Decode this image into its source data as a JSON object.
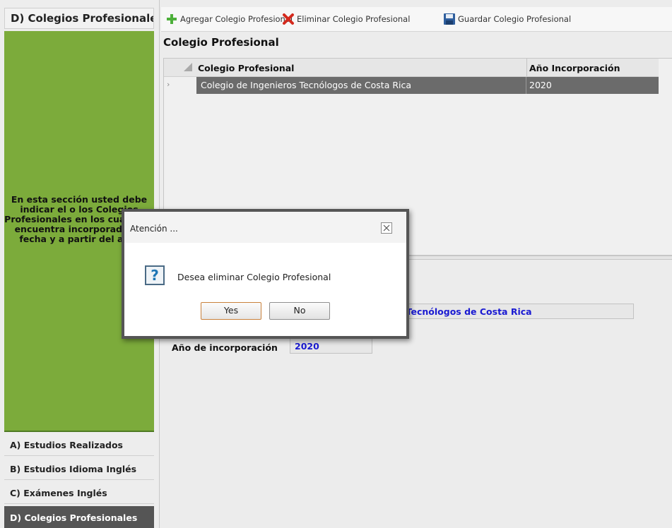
{
  "left_panel": {
    "header": "D) Colegios Profesionales",
    "description": "En esta sección usted debe indicar el o los Colegios Profesionales en los cuales se encuentra incorporado, la fecha y a partir del año.",
    "nav": [
      {
        "label": "A) Estudios Realizados",
        "active": false
      },
      {
        "label": "B) Estudios Idioma Inglés",
        "active": false
      },
      {
        "label": "C) Exámenes Inglés",
        "active": false
      },
      {
        "label": "D) Colegios Profesionales",
        "active": true
      }
    ]
  },
  "toolbar": {
    "add_label": "Agregar Colegio Profesional",
    "delete_label": "Eliminar Colegio Profesional",
    "save_label": "Guardar Colegio Profesional"
  },
  "section_title": "Colegio Profesional",
  "grid": {
    "columns": [
      "Colegio Profesional",
      "Año Incorporación"
    ],
    "rows": [
      {
        "colegio": "Colegio de Ingenieros Tecnólogos de Costa Rica",
        "anio": "2020"
      }
    ]
  },
  "detail": {
    "name_value": "Colegio de Ingenieros Tecnólogos de Costa Rica",
    "year_label": "Año de incorporación",
    "year_value": "2020"
  },
  "dialog": {
    "title": "Atención ...",
    "message": "Desea eliminar Colegio Profesional",
    "yes_label": "Yes",
    "no_label": "No"
  },
  "colors": {
    "green_panel": "#7cab3b",
    "selected_row": "#6b6b6b",
    "value_text": "#1a1ad2",
    "active_nav": "#555555"
  }
}
